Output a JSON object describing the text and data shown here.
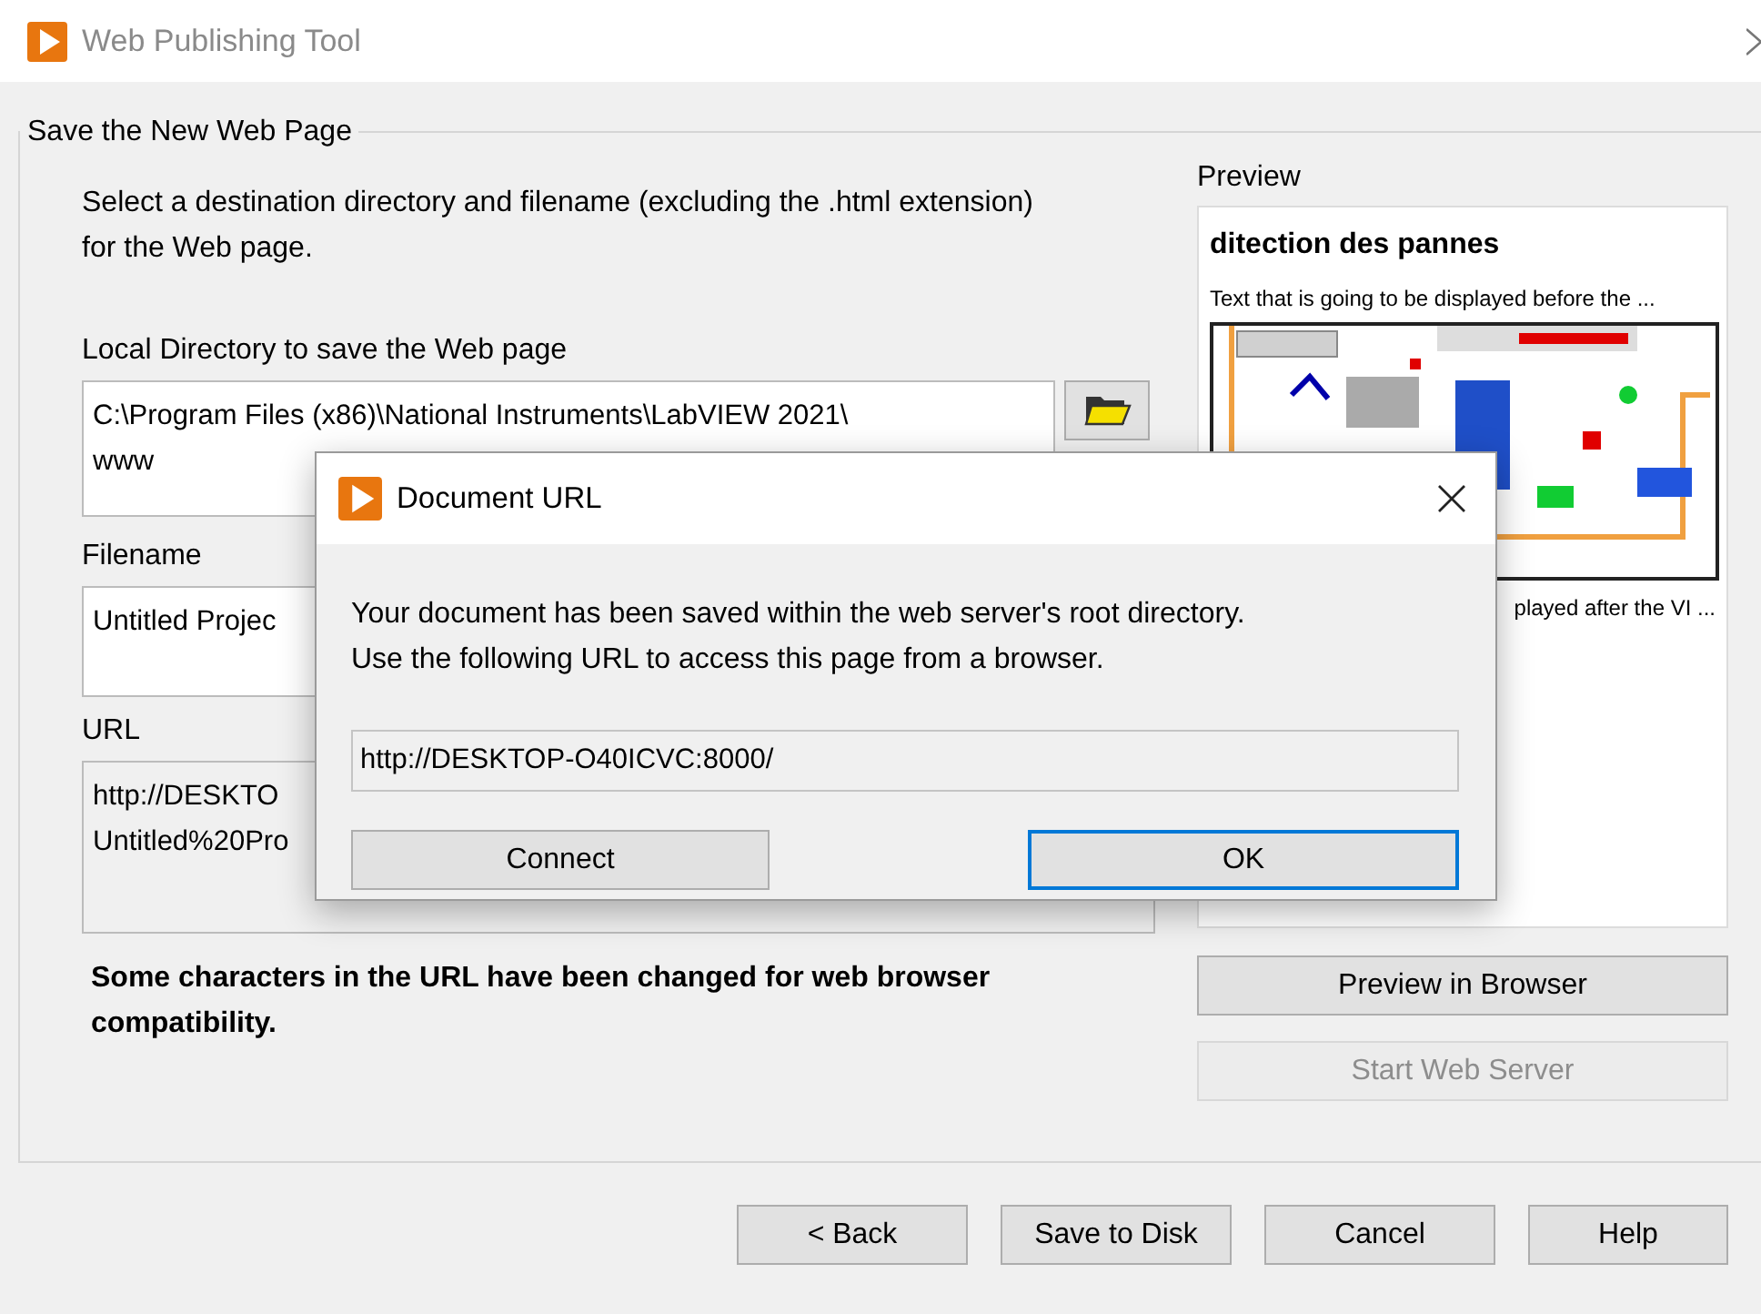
{
  "window": {
    "title": "Web Publishing Tool"
  },
  "group": {
    "title": "Save the New Web Page",
    "instructions": "Select a destination directory and filename (excluding the .html extension) for the Web page.",
    "fields": [
      {
        "label": "Local Directory to save the Web page",
        "kind": "browse",
        "readonly": false,
        "lines": [
          "C:\\Program Files (x86)\\National Instruments\\LabVIEW 2021\\",
          "www"
        ]
      },
      {
        "label": "Filename",
        "kind": "text",
        "readonly": false,
        "lines": [
          "Untitled Projec"
        ]
      },
      {
        "label": "URL",
        "kind": "text",
        "readonly": true,
        "lines": [
          "http://DESKTO",
          "Untitled%20Pro"
        ]
      }
    ],
    "note": "Some characters in the URL have been changed for web browser compatibility."
  },
  "preview": {
    "label": "Preview",
    "title": "ditection des pannes",
    "text_before": "Text that is going to be displayed before the ...",
    "text_after": "played after the VI ..."
  },
  "side_buttons": [
    {
      "label": "Preview in Browser",
      "disabled": false
    },
    {
      "label": "Start Web Server",
      "disabled": true
    }
  ],
  "buttons": [
    {
      "label": "< Back"
    },
    {
      "label": "Save to Disk"
    },
    {
      "label": "Cancel"
    },
    {
      "label": "Help"
    }
  ],
  "dialog": {
    "title": "Document URL",
    "message_lines": [
      "Your document has been saved within the web server's root directory.",
      "Use the following URL to access this page from a browser."
    ],
    "url": "http://DESKTOP-O40ICVC:8000/",
    "buttons": [
      {
        "label": "Connect",
        "default": false
      },
      {
        "label": "OK",
        "default": true
      }
    ]
  }
}
